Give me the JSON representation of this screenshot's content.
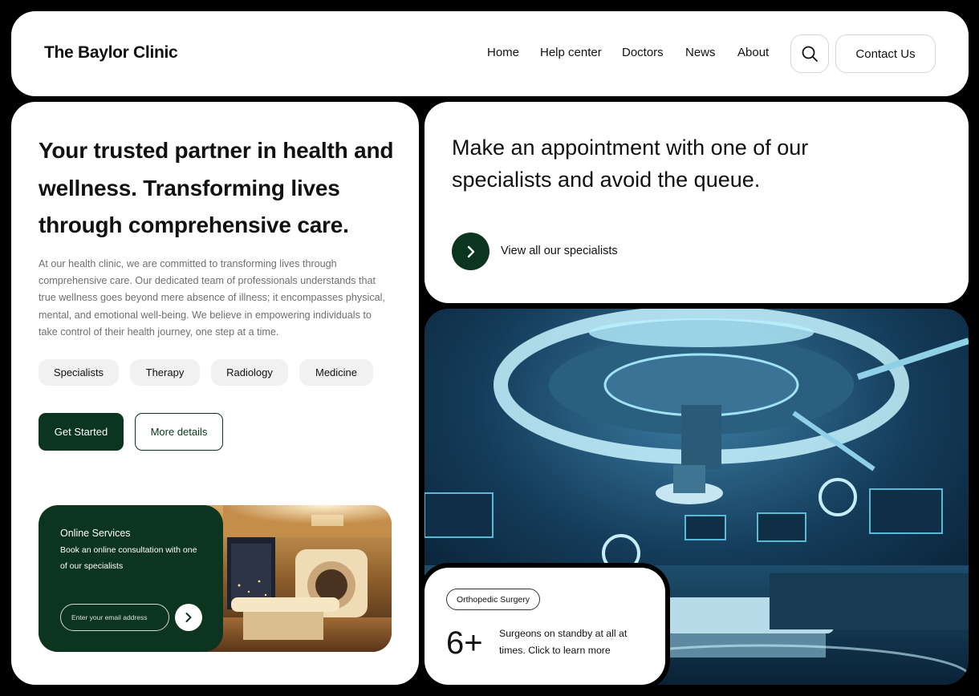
{
  "header": {
    "logo": "The Baylor Clinic",
    "nav": [
      "Home",
      "Help center",
      "Doctors",
      "News",
      "About"
    ],
    "contact_label": "Contact Us"
  },
  "hero": {
    "title": "Your trusted partner in health and wellness. Transforming lives through comprehensive care.",
    "description": "At our health clinic, we are committed to transforming lives through comprehensive care. Our dedicated team of professionals understands that true wellness goes beyond mere absence of illness; it encompasses physical, mental, and emotional well-being. We believe in empowering individuals to take control of their health journey, one step at a time.",
    "tags": [
      "Specialists",
      "Therapy",
      "Radiology",
      "Medicine"
    ],
    "primary_button": "Get Started",
    "secondary_button": "More details"
  },
  "services": {
    "title": "Online Services",
    "description": "Book an online consultation with one of our specialists",
    "email_placeholder": "Enter your email address"
  },
  "appointment": {
    "title": "Make an appointment with one of our specialists and avoid the queue.",
    "link": "View all our specialists"
  },
  "stat": {
    "badge": "Orthopedic Surgery",
    "number": "6+",
    "text": "Surgeons on standby at all at times. Click to learn more"
  },
  "colors": {
    "brand": "#0c3520",
    "background": "#000000",
    "card": "#ffffff",
    "tag_bg": "#f1f1f1"
  },
  "icons": [
    "search-icon",
    "chevron-right-icon"
  ]
}
